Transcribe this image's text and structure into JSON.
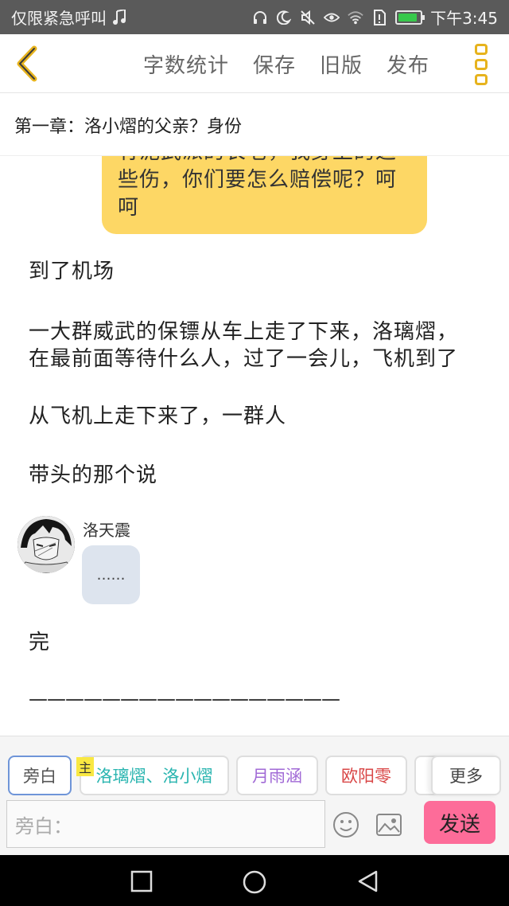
{
  "status_bar": {
    "carrier": "仅限紧急呼叫",
    "time": "下午3:45",
    "battery_level": 0.9
  },
  "toolbar": {
    "actions": [
      "字数统计",
      "保存",
      "旧版",
      "发布"
    ],
    "accent_color": "#e7b31d"
  },
  "chapter": {
    "title": "第一章：洛小熠的父亲？身份"
  },
  "story": {
    "bubble_lines": [
      "有泥武派的长老，我身上的这",
      "些伤，你们要怎么赔偿呢？呵",
      "呵"
    ],
    "paragraphs": [
      "到了机场",
      "一大群威武的保镖从车上走了下来，洛璃熠，",
      "在最前面等待什么人，过了一会儿，飞机到了",
      "从飞机上走下来了，一群人",
      "带头的那个说"
    ],
    "dialogue": {
      "speaker": "洛天震",
      "text": "……"
    },
    "end_text": "完",
    "divider": "—————————————————"
  },
  "composer": {
    "chips": {
      "narrator": "旁白",
      "main_tag": "主",
      "main": "洛璃熠、洛小熠",
      "yue": "月雨涵",
      "ouyang": "欧阳零",
      "more": "更多"
    },
    "input_placeholder": "旁白：",
    "send_label": "发送",
    "send_color": "#fd6c99"
  }
}
